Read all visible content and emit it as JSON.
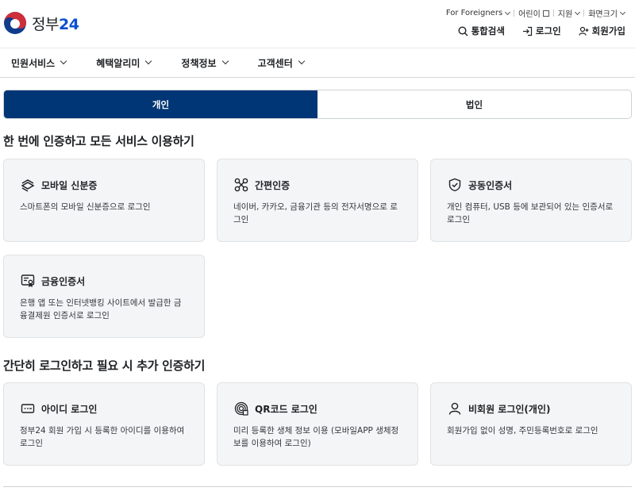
{
  "header": {
    "logo_text": "정부",
    "logo_num": "24",
    "util_links": [
      {
        "label": "For Foreigners",
        "icon": "chevron-down-icon"
      },
      {
        "label": "어린이",
        "icon": "external-link-icon"
      },
      {
        "label": "지원",
        "icon": "chevron-down-icon"
      },
      {
        "label": "화면크기",
        "icon": "chevron-down-icon"
      }
    ],
    "actions": {
      "search": "통합검색",
      "login": "로그인",
      "signup": "회원가입"
    }
  },
  "gnb": [
    "민원서비스",
    "혜택알리미",
    "정책정보",
    "고객센터"
  ],
  "tabs": {
    "personal": "개인",
    "corporate": "법인",
    "active": "personal"
  },
  "section1": {
    "title": "한 번에 인증하고 모든 서비스 이용하기",
    "cards": [
      {
        "icon": "mobile-id-icon",
        "title": "모바일 신분증",
        "desc": "스마트폰의 모바일 신분증으로 로그인"
      },
      {
        "icon": "simple-auth-icon",
        "title": "간편인증",
        "desc": "네이버, 카카오, 금융기관 등의 전자서명으로 로그인"
      },
      {
        "icon": "shield-check-icon",
        "title": "공동인증서",
        "desc": "개인 컴퓨터, USB 등에 보관되어 있는 인증서로 로그인"
      },
      {
        "icon": "certificate-icon",
        "title": "금융인증서",
        "desc": "은행 앱 또는 인터넷뱅킹 사이트에서 발급한 금융결제원 인증서로 로그인"
      }
    ]
  },
  "section2": {
    "title": "간단히 로그인하고 필요 시 추가 인증하기",
    "cards": [
      {
        "icon": "id-password-icon",
        "title": "아이디 로그인",
        "desc": "정부24 회원 가입 시 등록한 아이디를 이용하여 로그인"
      },
      {
        "icon": "qr-code-icon",
        "title": "QR코드 로그인",
        "desc": "미리 등록한 생체 정보 이용 (모바일APP 생체정보를 이용하여 로그인)"
      },
      {
        "icon": "person-icon",
        "title": "비회원 로그인(개인)",
        "desc": "회원가입 없이 성명, 주민등록번호로 로그인"
      }
    ]
  },
  "colors": {
    "primary": "#003675",
    "accent_red": "#cd2e3a",
    "accent_blue": "#0f64cd",
    "card_bg": "#f4f5f6"
  }
}
